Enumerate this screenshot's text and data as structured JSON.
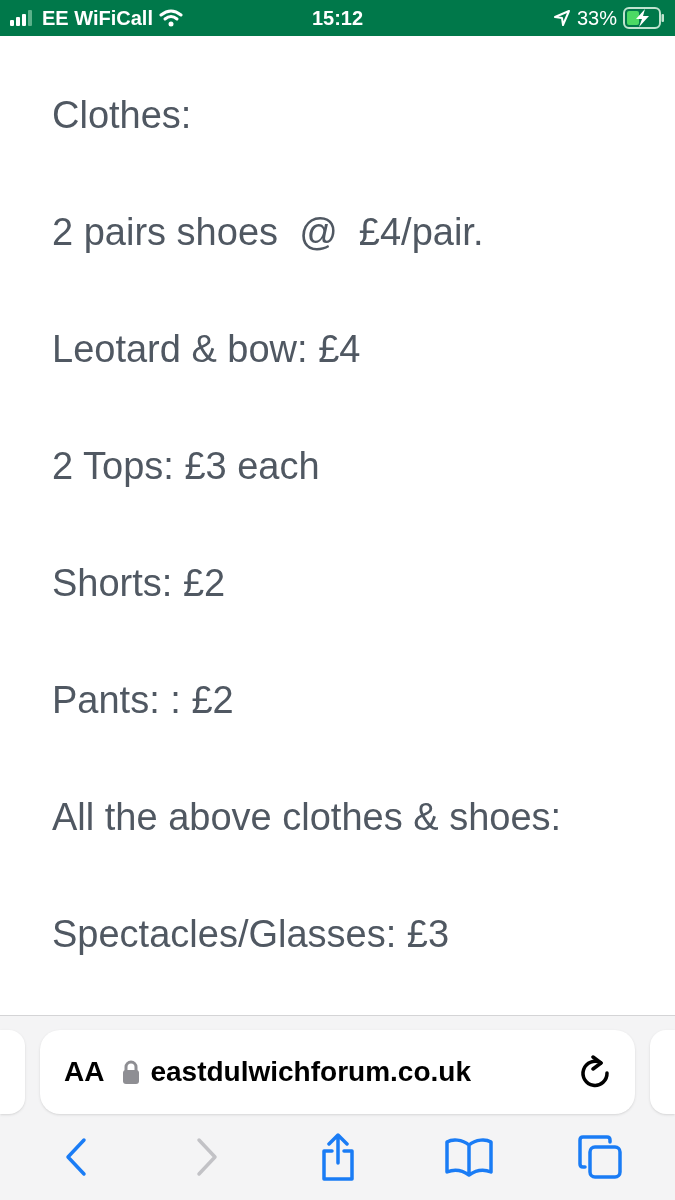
{
  "status_bar": {
    "carrier": "EE WiFiCall",
    "time": "15:12",
    "battery": "33%"
  },
  "content": {
    "lines": [
      "Clothes:",
      "2 pairs shoes  @  £4/pair.",
      "Leotard & bow: £4",
      "2 Tops: £3 each",
      "Shorts: £2",
      "Pants: : £2",
      "All the above clothes & shoes:",
      "Spectacles/Glasses: £3"
    ]
  },
  "address_bar": {
    "text_size": "AA",
    "url": "eastdulwichforum.co.uk"
  },
  "toolbar": [
    {
      "kind": "back",
      "disabled": false
    },
    {
      "kind": "forward",
      "disabled": true
    },
    {
      "kind": "share",
      "disabled": false
    },
    {
      "kind": "bookmarks",
      "disabled": false
    },
    {
      "kind": "tabs",
      "disabled": false
    }
  ]
}
